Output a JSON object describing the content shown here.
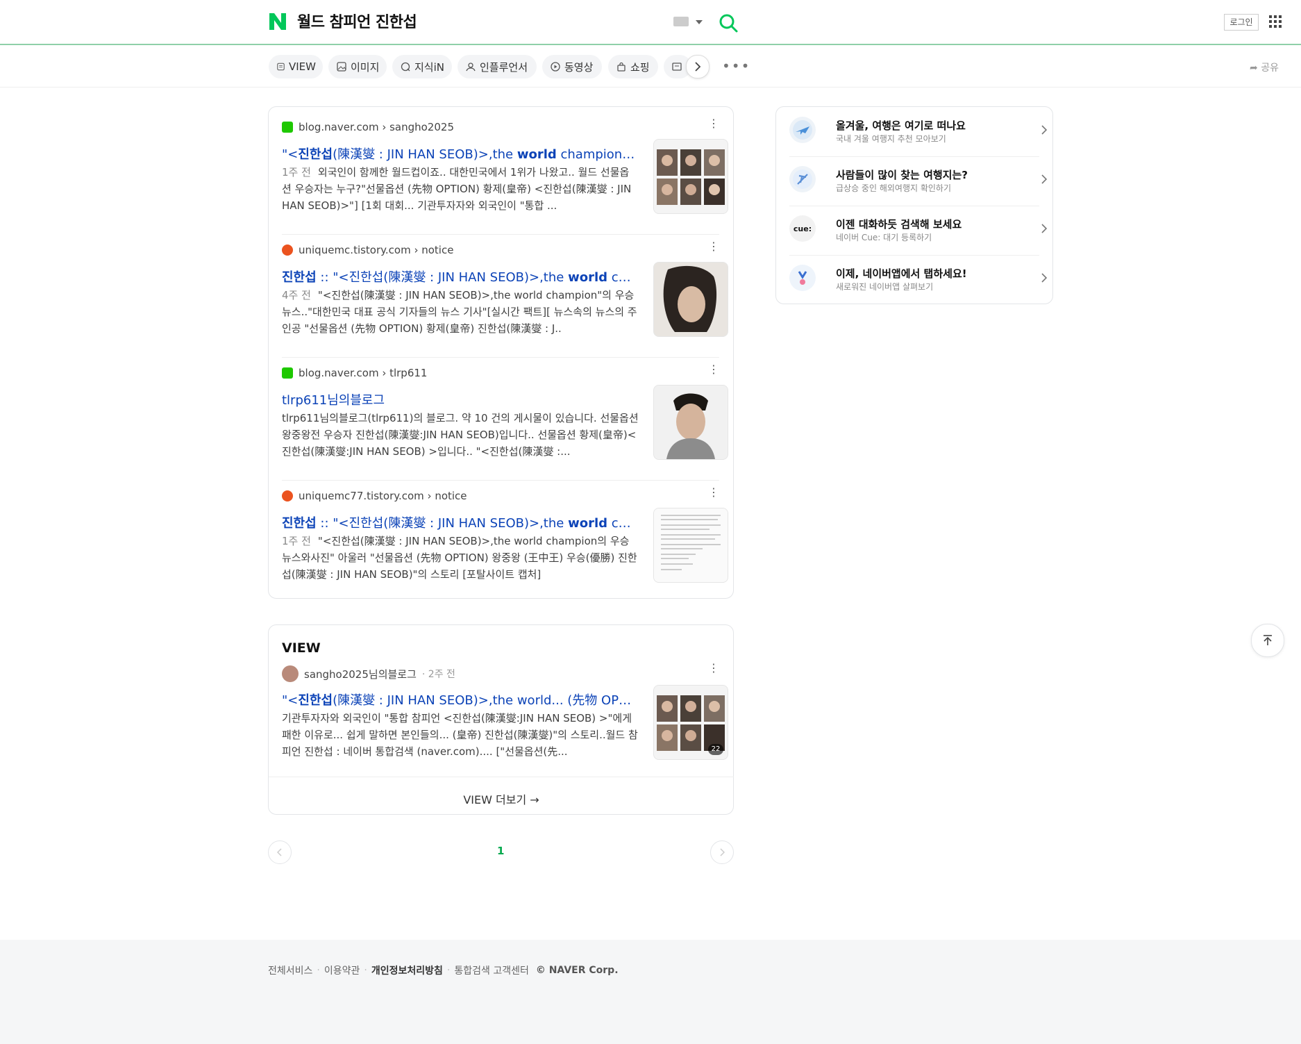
{
  "header": {
    "query": "월드 참피언 진한섭",
    "login_label": "로그인"
  },
  "tabs": [
    {
      "label": "VIEW",
      "icon": "view-icon"
    },
    {
      "label": "이미지",
      "icon": "image-icon"
    },
    {
      "label": "지식iN",
      "icon": "chat-icon"
    },
    {
      "label": "인플루언서",
      "icon": "person-icon"
    },
    {
      "label": "동영상",
      "icon": "play-icon"
    },
    {
      "label": "쇼핑",
      "icon": "bag-icon"
    }
  ],
  "share_label": "공유",
  "results": [
    {
      "source": "blog.naver.com › sangho2025",
      "source_type": "blog",
      "title_pre": "\"<",
      "title_bold1": "진한섭",
      "title_mid": "(陳漢燮 : JIN HAN SEOB)>,the ",
      "title_bold2": "world",
      "title_post": " champion의 우...",
      "date": "1주 전",
      "desc": "외국인이 함께한 월드컵이죠.. 대한민국에서 1위가 나왔고.. 월드 선물옵션 우승자는 누구?\"선물옵션 (先物 OPTION) 황제(皇帝) <진한섭(陳漢燮 : JIN HAN SEOB)>\"] [1회 대회... 기관투자자와 외국인이 \"통합 ..."
    },
    {
      "source": "uniquemc.tistory.com › notice",
      "source_type": "tistory",
      "title_pre": "",
      "title_bold1": "진한섭",
      "title_mid": " :: \"<진한섭(陳漢燮 : JIN HAN SEOB)>,the ",
      "title_bold2": "world",
      "title_post": " champi...",
      "date": "4주 전",
      "desc": "\"<진한섭(陳漢燮 : JIN HAN SEOB)>,the world champion\"의 우승 뉴스..\"대한민국 대표 공식 기자들의 뉴스 기사\"[실시간 팩트][ 뉴스속의 뉴스의 주인공 \"선물옵션 (先物 OPTION) 황제(皇帝) 진한섭(陳漢燮 : J.."
    },
    {
      "source": "blog.naver.com › tlrp611",
      "source_type": "blog",
      "title_pre": "tlrp611님의블로그",
      "title_bold1": "",
      "title_mid": "",
      "title_bold2": "",
      "title_post": "",
      "date": "",
      "desc": "tlrp611님의블로그(tlrp611)의 블로그. 약 10 건의 게시물이 있습니다. 선물옵션 왕중왕전 우승자 진한섭(陳漢燮:JIN HAN SEOB)입니다.. 선물옵션 황제(皇帝)< 진한섭(陳漢燮:JIN HAN SEOB) >입니다.. \"<진한섭(陳漢燮 :..."
    },
    {
      "source": "uniquemc77.tistory.com › notice",
      "source_type": "tistory",
      "title_pre": "",
      "title_bold1": "진한섭",
      "title_mid": " :: \"<진한섭(陳漢燮 : JIN HAN SEOB)>,the ",
      "title_bold2": "world",
      "title_post": " champi...",
      "date": "1주 전",
      "desc": "\"<진한섭(陳漢燮 : JIN HAN SEOB)>,the world champion의 우승 뉴스와사진\" 아울러 \"선물옵션 (先物 OPTION) 왕중왕 (王中王) 우승(優勝) 진한섭(陳漢燮 : JIN HAN SEOB)\"의 스토리 [포탈사이트 캡처]"
    }
  ],
  "view_section": {
    "heading": "VIEW",
    "author": "sangho2025님의블로그",
    "time": "· 2주 전",
    "title_pre": "\"<",
    "title_bold": "진한섭",
    "title_post": "(陳漢燮 : JIN HAN SEOB)>,the world... (先物 OPTION) ...",
    "desc": "기관투자자와 외국인이 \"통합 참피언 <진한섭(陳漢燮:JIN HAN SEOB) >\"에게 패한 이유로... 쉽게 말하면 본인들의... (皇帝) 진한섭(陳漢燮)\"의 스토리..월드 참피언 진한섭 : 네이버 통합검색 (naver.com).... [\"선물옵션(先...",
    "image_count": "22",
    "more_label": "VIEW 더보기 →"
  },
  "pagination": {
    "current": "1"
  },
  "side": [
    {
      "title": "올겨울, 여행은 여기로 떠나요",
      "sub": "국내 겨울 여행지 추천 모아보기",
      "icon": "airplane-icon"
    },
    {
      "title": "사람들이 많이 찾는 여행지는?",
      "sub": "급상승 중인 해외여행지 확인하기",
      "icon": "plane-globe-icon"
    },
    {
      "title": "이젠 대화하듯 검색해 보세요",
      "sub": "네이버 Cue: 대기 등록하기",
      "icon": "cue-icon",
      "badge": "cue:"
    },
    {
      "title": "이제, 네이버앱에서 탭하세요!",
      "sub": "새로워진 네이버앱 살펴보기",
      "icon": "naver-app-icon"
    }
  ],
  "footer": {
    "links": [
      "전체서비스",
      "이용약관",
      "개인정보처리방침",
      "통합검색 고객센터"
    ],
    "copyright": "© NAVER Corp."
  },
  "colors": {
    "brand_green": "#03c75a",
    "link_blue": "#0c43b7"
  }
}
